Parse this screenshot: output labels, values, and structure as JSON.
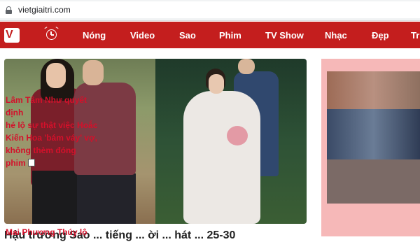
{
  "browser": {
    "url": "vietgiaitri.com"
  },
  "nav": {
    "logo_icon": "vietgiaitri-logo",
    "clock_icon": "clock-icon",
    "items": [
      {
        "label": "Nóng"
      },
      {
        "label": "Video"
      },
      {
        "label": "Sao"
      },
      {
        "label": "Phim"
      },
      {
        "label": "TV Show"
      },
      {
        "label": "Nhạc"
      },
      {
        "label": "Đẹp"
      },
      {
        "label": "Tr"
      }
    ],
    "colors": {
      "bar": "#c41e1e",
      "text": "#ffffff"
    }
  },
  "main": {
    "headline_partial": "Hậu trường Sao ... tiếng ... ời ... hát ... 25-30"
  },
  "sidebar": {
    "caption_lines": [
      "Lâm Tâm Như quyết định",
      "hé lộ sự thật việc Hoắc",
      "Kiến Hoa 'bám váy' vợ,",
      "không thèm đóng",
      "phim"
    ],
    "next_caption": "Mai Phương Thúy lộ",
    "colors": {
      "background": "#f6b8b8",
      "text": "#d4102a"
    }
  }
}
